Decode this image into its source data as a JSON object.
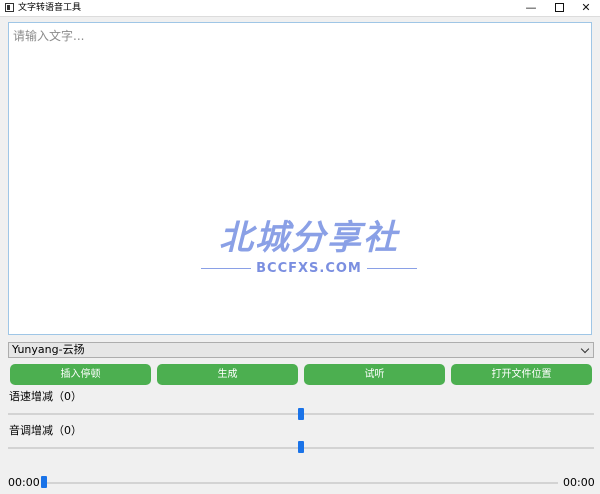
{
  "window": {
    "title": "文字转语音工具",
    "controls": {
      "minimize": "—",
      "close": "✕"
    }
  },
  "editor": {
    "placeholder": "请输入文字..."
  },
  "watermark": {
    "main": "北城分享社",
    "sub": "BCCFXS.COM"
  },
  "voice": {
    "selected": "Yunyang-云扬"
  },
  "buttons": {
    "insert_pause": "插入停顿",
    "generate": "生成",
    "preview": "试听",
    "open_folder": "打开文件位置"
  },
  "speed": {
    "label": "语速增减（0）",
    "value": 0
  },
  "pitch": {
    "label": "音调增减（0）",
    "value": 0
  },
  "playback": {
    "current_time": "00:00",
    "total_time": "00:00",
    "progress": 0
  },
  "colors": {
    "button_green": "#4caf50",
    "slider_handle": "#1a73e8",
    "editor_border": "#9fc6e6"
  }
}
